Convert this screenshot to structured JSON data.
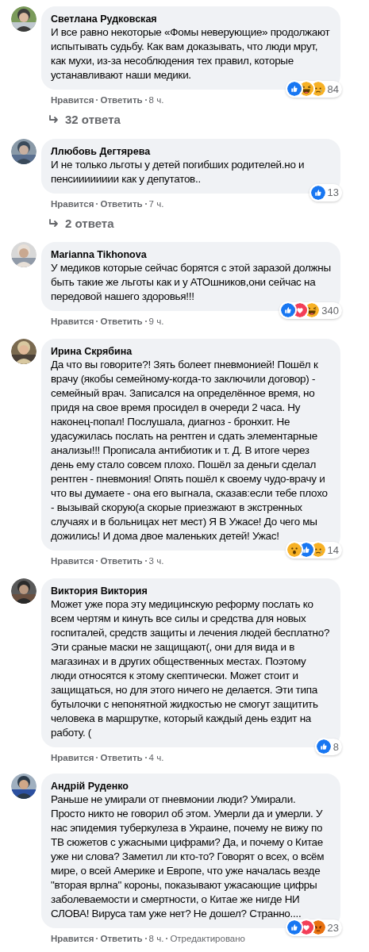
{
  "comments": [
    {
      "author": "Светлана Рудковская",
      "text": "И все равно некоторые «Фомы неверующие» продолжают испытывать судьбу. Как вам доказывать, что люди мрут, как мухи, из-за несоблюдения тех правил, которые устанавливают наши медики.",
      "reactions": [
        {
          "kind": "like"
        },
        {
          "kind": "haha"
        },
        {
          "kind": "sad"
        }
      ],
      "reaction_count": "84",
      "like": "Нравится",
      "reply": "Ответить",
      "time": "8 ч.",
      "replies": "32 ответа"
    },
    {
      "author": "Ллюбовь Дегтярева",
      "text": "И не только льготы у детей погибших родителей.но и пенсииииииии как у депутатов..",
      "reactions": [
        {
          "kind": "like"
        }
      ],
      "reaction_count": "13",
      "like": "Нравится",
      "reply": "Ответить",
      "time": "7 ч.",
      "replies": "2 ответа"
    },
    {
      "author": "Marianna Tikhonova",
      "text": "У медиков которые сейчас борятся с этой заразой должны быть такие же льготы как и у АТОшников,они сейчас на передовой нашего здоровья!!!",
      "reactions": [
        {
          "kind": "like"
        },
        {
          "kind": "love"
        },
        {
          "kind": "haha"
        }
      ],
      "reaction_count": "340",
      "like": "Нравится",
      "reply": "Ответить",
      "time": "9 ч."
    },
    {
      "author": "Ирина Скрябина",
      "text": "Да что вы говорите?! Зять болеет пневмонией! Пошёл к врачу (якобы семейному-когда-то заключили договор) - семейный врач. Записался на определённое время, но придя на свое время просидел в очереди 2 часа. Ну наконец-попал! Послушала, диагноз - бронхит. Не удасужилась послать на рентген и сдать элементарные анализы!!! Прописала антибиотик и т. Д. В итоге через день ему стало совсем плохо. Пошёл за деньги сделал рентген - пневмония! Опять пошёл к своему чудо-врачу и что вы думаете - она его выгнала, сказав:если тебе плохо - вызывай скорую(а скорые приезжают в экстренных случаях и в больницах нет мест) Я В Ужасе! До чего мы дожились! И дома двое маленьких детей! Ужас!",
      "reactions": [
        {
          "kind": "wow"
        },
        {
          "kind": "like"
        },
        {
          "kind": "sad"
        }
      ],
      "reaction_count": "14",
      "like": "Нравится",
      "reply": "Ответить",
      "time": "3 ч."
    },
    {
      "author": "Виктория Виктория",
      "text": "Может уже пора эту медицинскую реформу послать ко всем чертям и кинуть все силы и средства для новых госпиталей, средств защиты и лечения людей бесплатно? Эти сраные маски не защищают(, они для вида и в магазинах и в других общественных местах. Поэтому люди относятся к этому скептически. Может стоит и защищаться, но для этого ничего не делается. Эти типа бутылочки с непонятной жидкостью не смогут защитить человека в маршрутке, который каждый день ездит на работу. (",
      "reactions": [
        {
          "kind": "like"
        }
      ],
      "reaction_count": "8",
      "like": "Нравится",
      "reply": "Ответить",
      "time": "4 ч."
    },
    {
      "author": "Андрій Руденко",
      "text": "Раньше не умирали от пневмонии люди? Умирали. Просто никто не говорил об этом. Умерли да и умерли. У нас эпидемия туберкулеза в Украине, почему не вижу по ТВ сюжетов с ужасными цифрами? Да, и почему о Китае уже ни слова? Заметил ли кто-то? Говорят о всех, о всём мире, о всей Америке и Европе, что уже началась везде \"вторая врлна\" короны, показывают ужасающие цифры заболеваемости и смертности, о Китае же нигде НИ СЛОВА! Вируса там уже нет? Не дошел? Странно....",
      "reactions": [
        {
          "kind": "like"
        },
        {
          "kind": "love"
        },
        {
          "kind": "angry"
        }
      ],
      "reaction_count": "23",
      "like": "Нравится",
      "reply": "Ответить",
      "time": "8 ч.",
      "edited": "Отредактировано"
    }
  ]
}
